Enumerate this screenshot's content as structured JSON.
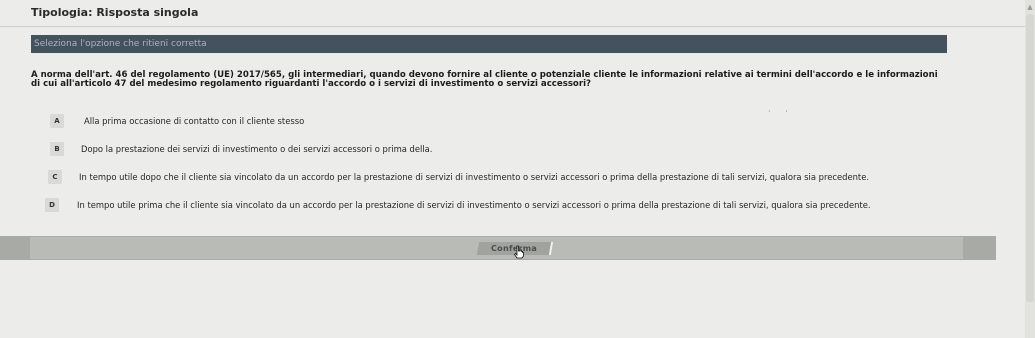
{
  "quiz": {
    "type_label": "Tipologia: Risposta singola",
    "instruction": "Seleziona l'opzione che ritieni corretta",
    "question": "A norma dell'art. 46 del regolamento (UE) 2017/565, gli intermediari, quando devono fornire al cliente o potenziale cliente le informazioni relative ai termini dell'accordo e le informazioni di cui all'articolo 47 del medesimo regolamento riguardanti l'accordo o i servizi di investimento o servizi accessori?",
    "options": [
      {
        "letter": "A",
        "text": "Alla prima occasione di contatto con il cliente stesso"
      },
      {
        "letter": "B",
        "text": "Dopo la prestazione dei servizi di investimento o dei servizi accessori o prima della."
      },
      {
        "letter": "C",
        "text": "In tempo utile dopo che il cliente sia vincolato da un accordo per la prestazione di servizi di investimento o servizi accessori o prima della prestazione di tali servizi, qualora sia precedente."
      },
      {
        "letter": "D",
        "text": "In tempo utile prima che il cliente sia vincolato da un accordo per la prestazione di servizi di investimento o servizi accessori o prima della prestazione di tali servizi, qualora sia precedente."
      }
    ],
    "confirm_label": "Conferma"
  },
  "colors": {
    "instruction_bar": "#44525d",
    "confirm_bar": "#a8aaa6",
    "background": "#ececea"
  },
  "icons": {
    "cursor": "hand-pointer-icon",
    "scroll_up": "chevron-up-icon"
  }
}
